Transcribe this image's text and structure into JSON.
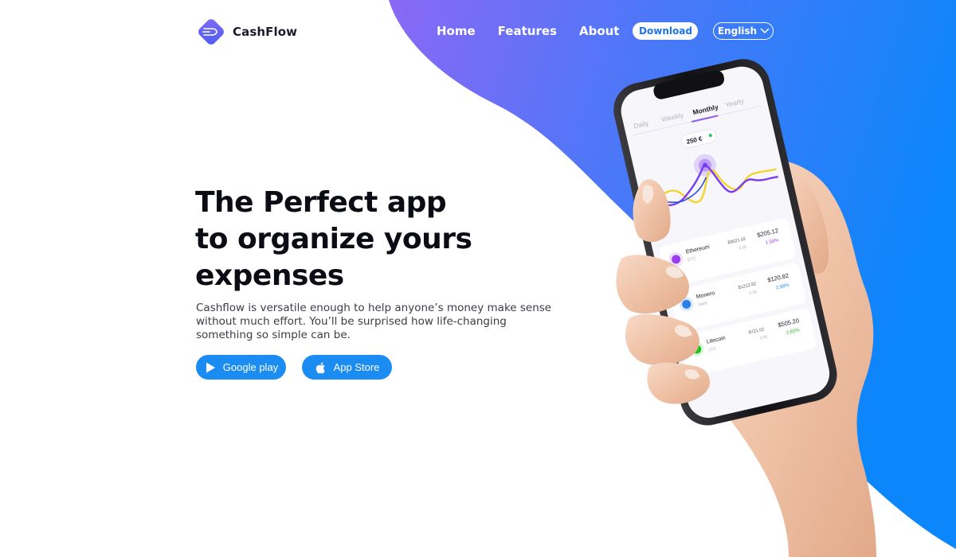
{
  "brand": {
    "name": "CashFlow",
    "logo_icon": "cashflow-logo-icon",
    "accent": "#1b8cf2"
  },
  "nav": {
    "links": [
      "Home",
      "Features",
      "About"
    ],
    "download_label": "Download",
    "language": "English"
  },
  "hero": {
    "title_lines": [
      "The Perfect app",
      "to organize yours",
      "expenses"
    ],
    "description": "Cashflow is versatile enough to help anyone’s money make sense without much effort. You’ll be surprised how life-changing something so simple can be.",
    "google_play_label": "Google play",
    "app_store_label": "App Store"
  },
  "phone_screen": {
    "tabs": [
      "Daily",
      "Weekly",
      "Monthly",
      "Yearly"
    ],
    "active_tab": "Monthly",
    "price_bubble": "250 €",
    "coins": [
      {
        "name": "Ethereum",
        "ticker": "ETC",
        "price": "$3021.02",
        "change_value": "0.00",
        "value": "$205.12",
        "change_pct": "1.58%",
        "color": "#9b3cf0",
        "pct_color": "#a23cf0"
      },
      {
        "name": "Monero",
        "ticker": "XMR",
        "price": "$1212.82",
        "change_value": "0.00",
        "value": "$120.82",
        "change_pct": "2.58%",
        "color": "#2a7ee8",
        "pct_color": "#1d8ef0"
      },
      {
        "name": "Litecoin",
        "ticker": "LTC",
        "price": "$721.02",
        "change_value": "0.00",
        "value": "$505.20",
        "change_pct": "2.82%",
        "color": "#1ec41e",
        "pct_color": "#22b522"
      }
    ]
  },
  "colors": {
    "gradient_start": "#7b6cf7",
    "gradient_end": "#0d86fb"
  }
}
